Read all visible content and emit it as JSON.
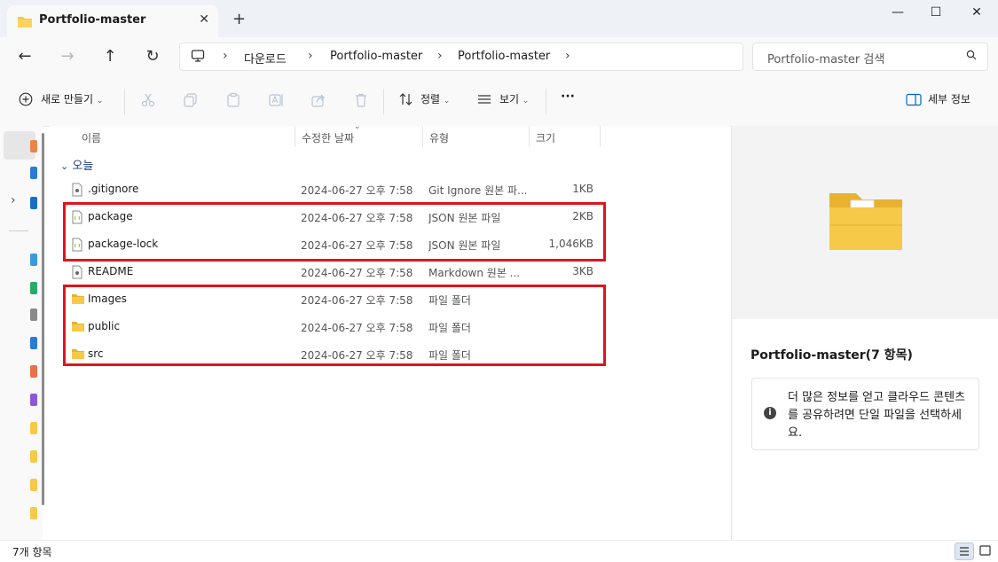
{
  "window": {
    "tab_title": "Portfolio-master",
    "tab_close": "✕",
    "new_tab": "+",
    "minimize": "—",
    "maximize": "☐",
    "close": "✕"
  },
  "nav": {
    "back": "←",
    "forward": "→",
    "up": "↑",
    "refresh": "↻"
  },
  "breadcrumb": [
    "다운로드",
    "Portfolio-master",
    "Portfolio-master"
  ],
  "search": {
    "placeholder": "Portfolio-master 검색"
  },
  "toolbar": {
    "new_label": "새로 만들기",
    "sort_label": "정렬",
    "view_label": "보기",
    "more_label": "···",
    "details_label": "세부 정보"
  },
  "columns": {
    "name": "이름",
    "date": "수정한 날짜",
    "type": "유형",
    "size": "크기"
  },
  "group_label": "오늘",
  "files": [
    {
      "name": ".gitignore",
      "date": "2024-06-27 오후 7:58",
      "type": "Git Ignore 원본 파...",
      "size": "1KB",
      "icon": "file-icon"
    },
    {
      "name": "package",
      "date": "2024-06-27 오후 7:58",
      "type": "JSON 원본 파일",
      "size": "2KB",
      "icon": "json-file-icon"
    },
    {
      "name": "package-lock",
      "date": "2024-06-27 오후 7:58",
      "type": "JSON 원본 파일",
      "size": "1,046KB",
      "icon": "json-file-icon"
    },
    {
      "name": "README",
      "date": "2024-06-27 오후 7:58",
      "type": "Markdown 원본 ...",
      "size": "3KB",
      "icon": "file-icon"
    },
    {
      "name": "Images",
      "date": "2024-06-27 오후 7:58",
      "type": "파일 폴더",
      "size": "",
      "icon": "folder-icon"
    },
    {
      "name": "public",
      "date": "2024-06-27 오후 7:58",
      "type": "파일 폴더",
      "size": "",
      "icon": "folder-icon"
    },
    {
      "name": "src",
      "date": "2024-06-27 오후 7:58",
      "type": "파일 폴더",
      "size": "",
      "icon": "folder-icon"
    }
  ],
  "details": {
    "title": "Portfolio-master(7 항목)",
    "info_text": "더 많은 정보를 얻고 클라우드 콘텐츠를 공유하려면 단일 파일을 선택하세요."
  },
  "status": {
    "item_count": "7개 항목"
  },
  "colors": {
    "highlight": "#e0141e",
    "folder": "#f7c948",
    "accent": "#0067c0"
  }
}
